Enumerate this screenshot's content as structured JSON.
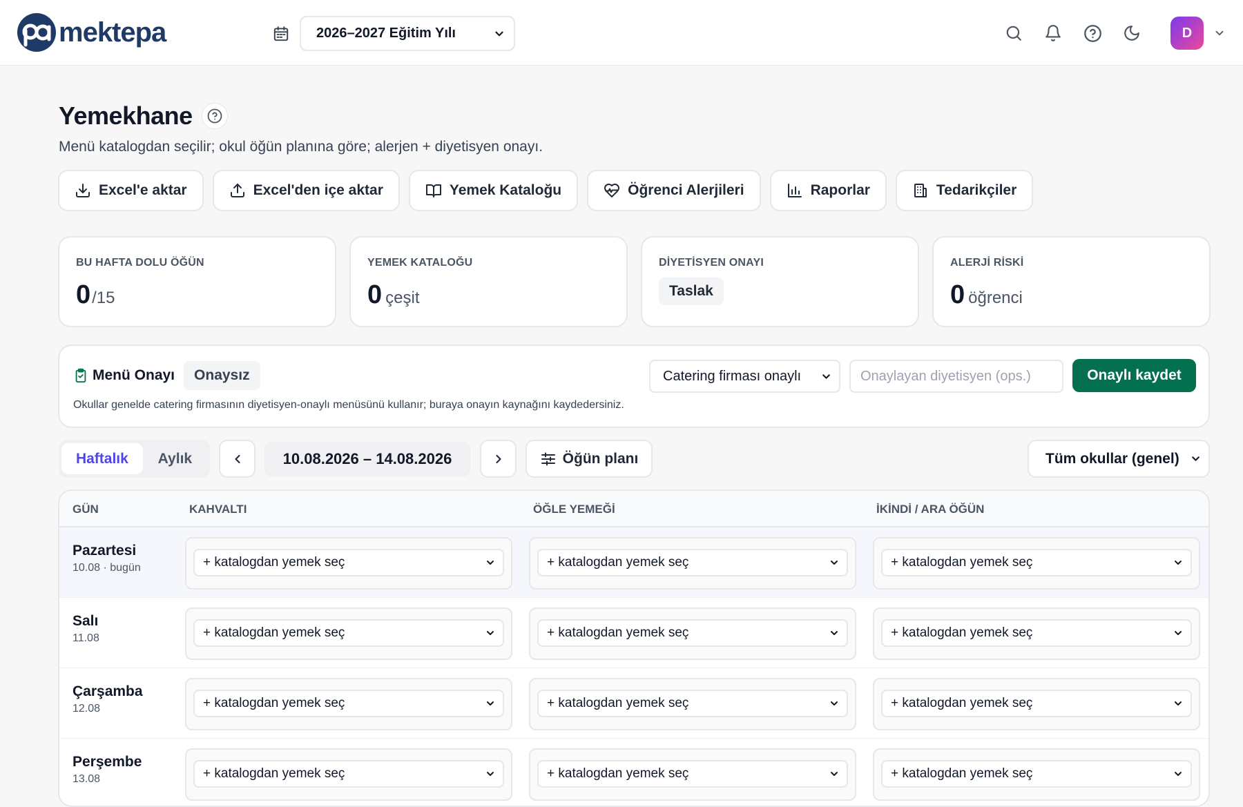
{
  "brand": {
    "name": "mektepa",
    "mark": "pa"
  },
  "header": {
    "academic_year": "2026–2027 Eğitim Yılı",
    "avatar_initial": "D"
  },
  "page": {
    "title": "Yemekhane",
    "subtitle": "Menü katalogdan seçilir; okul öğün planına göre; alerjen + diyetisyen onayı."
  },
  "actions": [
    {
      "label": "Excel'e aktar",
      "icon": "download-icon"
    },
    {
      "label": "Excel'den içe aktar",
      "icon": "upload-icon"
    },
    {
      "label": "Yemek Kataloğu",
      "icon": "book-icon"
    },
    {
      "label": "Öğrenci Alerjileri",
      "icon": "heart-pulse-icon"
    },
    {
      "label": "Raporlar",
      "icon": "bar-chart-icon"
    },
    {
      "label": "Tedarikçiler",
      "icon": "building-icon"
    }
  ],
  "stats": {
    "meals": {
      "label": "BU HAFTA DOLU ÖĞÜN",
      "value": "0",
      "suffix": "/15"
    },
    "catalog": {
      "label": "YEMEK KATALOĞU",
      "value": "0",
      "suffix": "çeşit"
    },
    "dietitian": {
      "label": "DİYETİSYEN ONAYI",
      "status": "Taslak"
    },
    "allergy": {
      "label": "ALERJİ RİSKİ",
      "value": "0",
      "suffix": "öğrenci"
    }
  },
  "approval": {
    "title": "Menü Onayı",
    "badge": "Onaysız",
    "description": "Okullar genelde catering firmasının diyetisyen-onaylı menüsünü kullanır; buraya onayın kaynağını kaydedersiniz.",
    "source_selected": "Catering firması onaylı",
    "dietitian_placeholder": "Onaylayan diyetisyen (ops.)",
    "save_label": "Onaylı kaydet"
  },
  "calendar": {
    "tabs": [
      "Haftalık",
      "Aylık"
    ],
    "range": "10.08.2026 – 14.08.2026",
    "plan_label": "Öğün planı",
    "school_selected": "Tüm okullar (genel)"
  },
  "table": {
    "headers": [
      "GÜN",
      "KAHVALTI",
      "ÖĞLE YEMEĞİ",
      "İKİNDİ / ARA ÖĞÜN"
    ],
    "dish_placeholder": "+ katalogdan yemek seç",
    "rows": [
      {
        "day": "Pazartesi",
        "date": "10.08 · bugün"
      },
      {
        "day": "Salı",
        "date": "11.08"
      },
      {
        "day": "Çarşamba",
        "date": "12.08"
      },
      {
        "day": "Perşembe",
        "date": "13.08"
      }
    ]
  },
  "colors": {
    "brand": "#1f3a66",
    "accent": "#4f46e5",
    "success": "#05704f"
  }
}
